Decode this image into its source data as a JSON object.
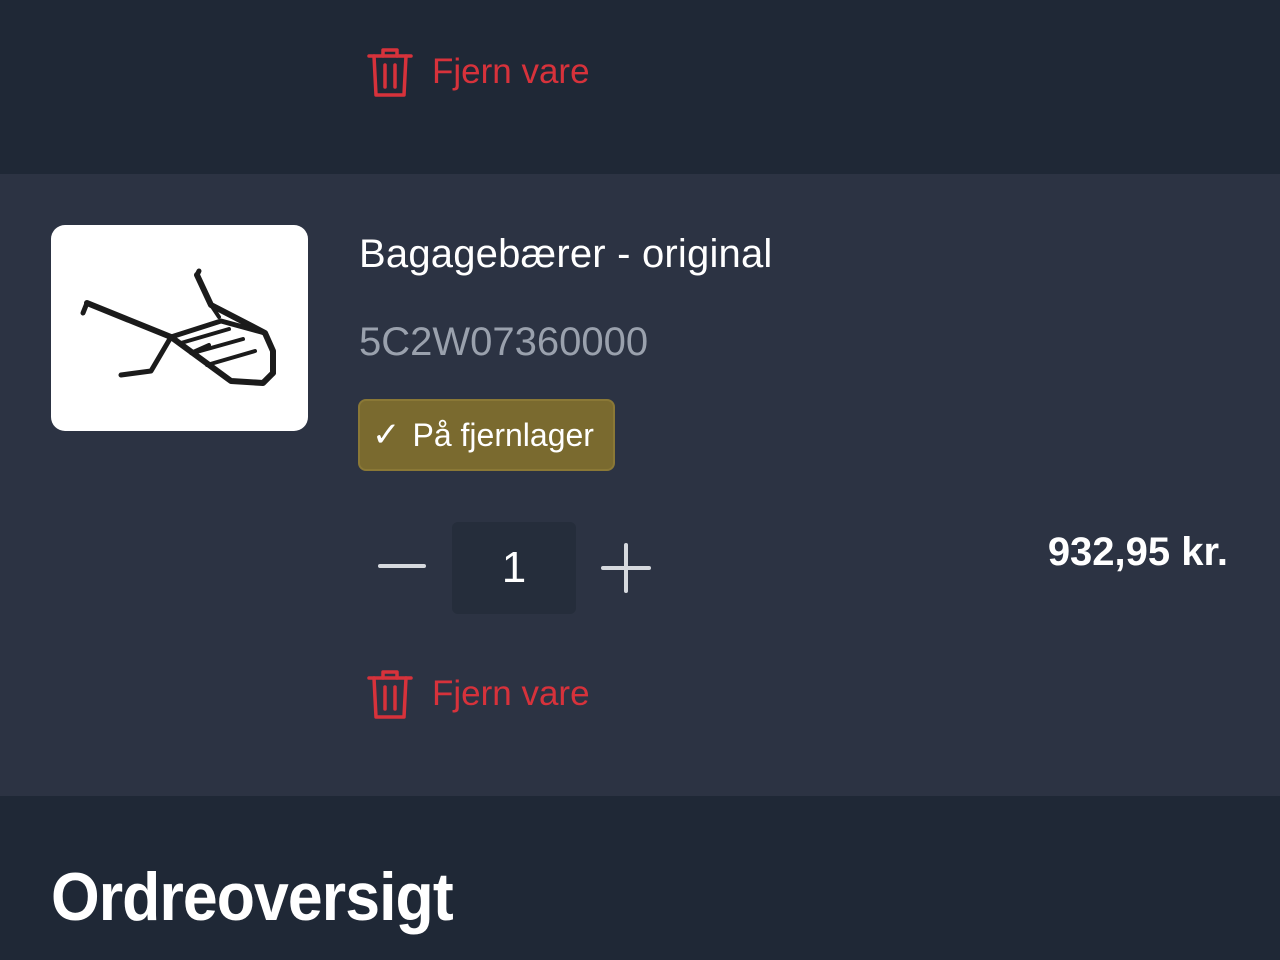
{
  "prev_item": {
    "remove_label": "Fjern vare"
  },
  "cart_item": {
    "product_name": "Bagagebærer - original",
    "sku": "5C2W07360000",
    "stock_status": "På fjernlager",
    "stock_icon": "✓",
    "quantity": "1",
    "price": "932,95 kr.",
    "remove_label": "Fjern vare"
  },
  "order_summary": {
    "title": "Ordreoversigt"
  },
  "colors": {
    "page_bg": "#1f2836",
    "card_bg": "#2c3343",
    "danger": "#d7323b",
    "stock_badge": "#7a6a2f"
  },
  "icons": {
    "remove": "trash-icon",
    "decrease": "minus-icon",
    "increase": "plus-icon",
    "stock": "checkmark-icon"
  }
}
